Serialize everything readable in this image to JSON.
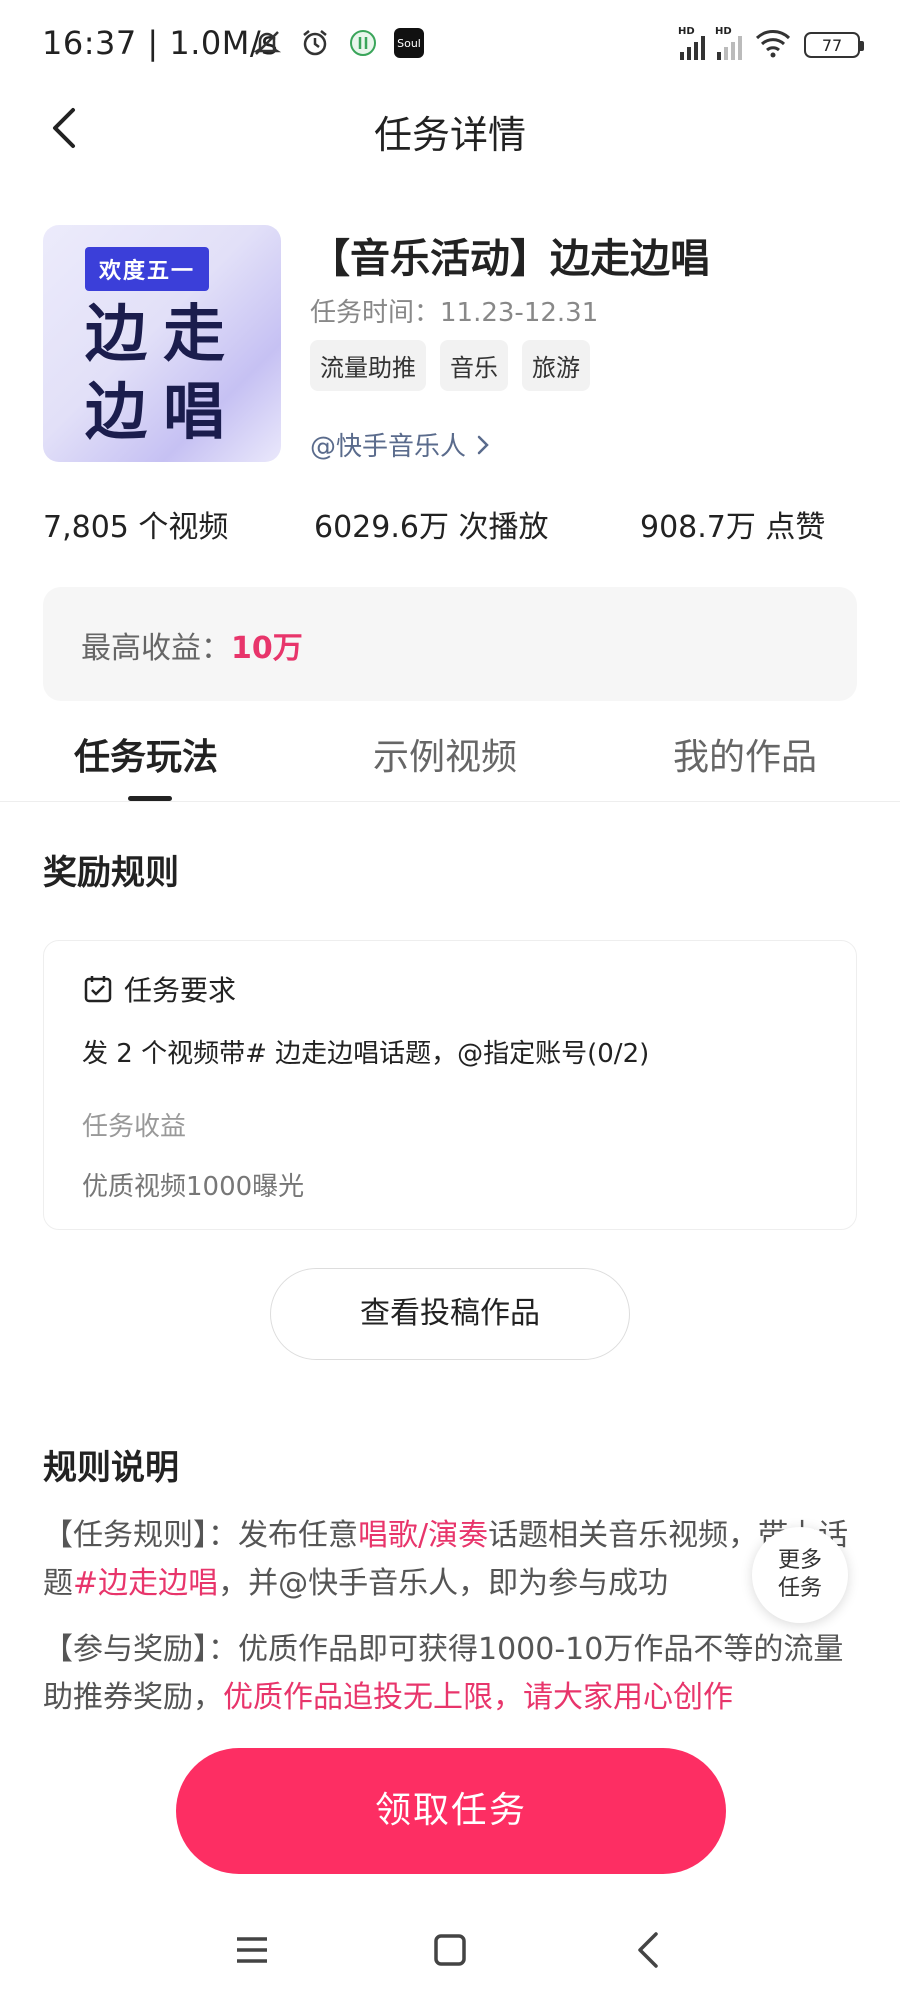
{
  "status_bar": {
    "time_speed": "16:37 | 1.0M/s",
    "soul_label": "Soul",
    "hd1": "HD",
    "hd2": "HD",
    "battery": "77"
  },
  "header": {
    "title": "任务详情"
  },
  "task": {
    "cover_badge": "欢度五一",
    "cover_line1": "边走",
    "cover_line2": "边唱",
    "title": "【音乐活动】边走边唱",
    "time": "任务时间：11.23-12.31",
    "tags": [
      "流量助推",
      "音乐",
      "旅游"
    ],
    "account": "@快手音乐人"
  },
  "stats": {
    "videos_num": "7,805",
    "videos_unit": " 个视频",
    "plays_num": "6029.6万",
    "plays_unit": " 次播放",
    "likes_num": "908.7万",
    "likes_unit": " 点赞"
  },
  "max_income": {
    "label": "最高收益：",
    "value": "10万"
  },
  "tabs": [
    "任务玩法",
    "示例视频",
    "我的作品"
  ],
  "reward_rules": {
    "title": "奖励规则",
    "req_title": "任务要求",
    "req_text": "发 2 个视频带# 边走边唱话题，@指定账号(0/2)",
    "income_label": "任务收益",
    "income_value": "优质视频1000曝光"
  },
  "view_submissions_label": "查看投稿作品",
  "rules_section": {
    "title": "规则说明",
    "p1_a": "【任务规则】：发布任意",
    "p1_b": "唱歌/演奏",
    "p1_c": "话题相关音乐视频，带上话题",
    "p1_d": "#边走边唱",
    "p1_e": "，并@快手音乐人，即为参与成功",
    "p2_a": "【参与奖励】：优质作品即可获得1000-10万作品不等的流量助推券奖励，",
    "p2_b": "优质作品追投无上限，请大家用心创作"
  },
  "more_tasks": {
    "line1": "更多",
    "line2": "任务"
  },
  "claim_button": "领取任务",
  "colors": {
    "accent_pink": "#fd2e63",
    "highlight_pink": "#e8356b",
    "link_blue": "#5a6b8c"
  }
}
